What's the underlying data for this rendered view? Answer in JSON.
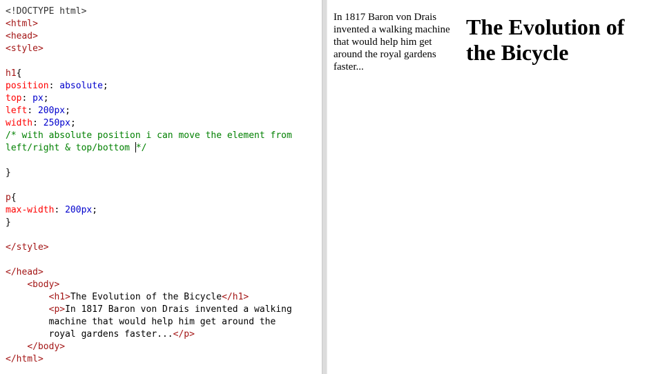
{
  "editor": {
    "lines": [
      [
        {
          "t": "<!DOCTYPE html>",
          "c": "doctype"
        }
      ],
      [
        {
          "t": "<html>",
          "c": "tag"
        }
      ],
      [
        {
          "t": "<head>",
          "c": "tag"
        }
      ],
      [
        {
          "t": "<style>",
          "c": "tag"
        }
      ],
      [],
      [
        {
          "t": "h1",
          "c": "sel"
        },
        {
          "t": "{",
          "c": "punc"
        }
      ],
      [
        {
          "t": "position",
          "c": "prop"
        },
        {
          "t": ": ",
          "c": "punc"
        },
        {
          "t": "absolute",
          "c": "val"
        },
        {
          "t": ";",
          "c": "punc"
        }
      ],
      [
        {
          "t": "top",
          "c": "prop"
        },
        {
          "t": ": ",
          "c": "punc"
        },
        {
          "t": "px",
          "c": "val"
        },
        {
          "t": ";",
          "c": "punc"
        }
      ],
      [
        {
          "t": "left",
          "c": "prop"
        },
        {
          "t": ": ",
          "c": "punc"
        },
        {
          "t": "200px",
          "c": "val"
        },
        {
          "t": ";",
          "c": "punc"
        }
      ],
      [
        {
          "t": "width",
          "c": "prop"
        },
        {
          "t": ": ",
          "c": "punc"
        },
        {
          "t": "250px",
          "c": "val"
        },
        {
          "t": ";",
          "c": "punc"
        }
      ],
      [
        {
          "t": "/* with absolute position i can move the element from",
          "c": "comment"
        }
      ],
      [
        {
          "t": "left/right & top/bottom ",
          "c": "comment"
        },
        {
          "caret": true
        },
        {
          "t": "*/",
          "c": "comment"
        }
      ],
      [],
      [
        {
          "t": "}",
          "c": "punc"
        }
      ],
      [],
      [
        {
          "t": "p",
          "c": "sel"
        },
        {
          "t": "{",
          "c": "punc"
        }
      ],
      [
        {
          "t": "max-width",
          "c": "prop"
        },
        {
          "t": ": ",
          "c": "punc"
        },
        {
          "t": "200px",
          "c": "val"
        },
        {
          "t": ";",
          "c": "punc"
        }
      ],
      [
        {
          "t": "}",
          "c": "punc"
        }
      ],
      [],
      [
        {
          "t": "</style>",
          "c": "tag"
        }
      ],
      [],
      [
        {
          "t": "</head>",
          "c": "tag"
        }
      ],
      [
        {
          "t": "    ",
          "c": "text"
        },
        {
          "t": "<body>",
          "c": "tag"
        }
      ],
      [
        {
          "t": "        ",
          "c": "text"
        },
        {
          "t": "<h1>",
          "c": "tag"
        },
        {
          "t": "The Evolution of the Bicycle",
          "c": "text"
        },
        {
          "t": "</h1>",
          "c": "tag"
        }
      ],
      [
        {
          "t": "        ",
          "c": "text"
        },
        {
          "t": "<p>",
          "c": "tag"
        },
        {
          "t": "In 1817 Baron von Drais invented a walking",
          "c": "text"
        }
      ],
      [
        {
          "t": "        machine that would help him get around the",
          "c": "text"
        }
      ],
      [
        {
          "t": "        royal gardens faster...",
          "c": "text"
        },
        {
          "t": "</p>",
          "c": "tag"
        }
      ],
      [
        {
          "t": "    ",
          "c": "text"
        },
        {
          "t": "</body>",
          "c": "tag"
        }
      ],
      [
        {
          "t": "</html>",
          "c": "tag"
        }
      ]
    ]
  },
  "preview": {
    "heading": "The Evolution of the Bicycle",
    "paragraph": "In 1817 Baron von Drais invented a walking machine that would help him get around the royal gardens faster..."
  }
}
